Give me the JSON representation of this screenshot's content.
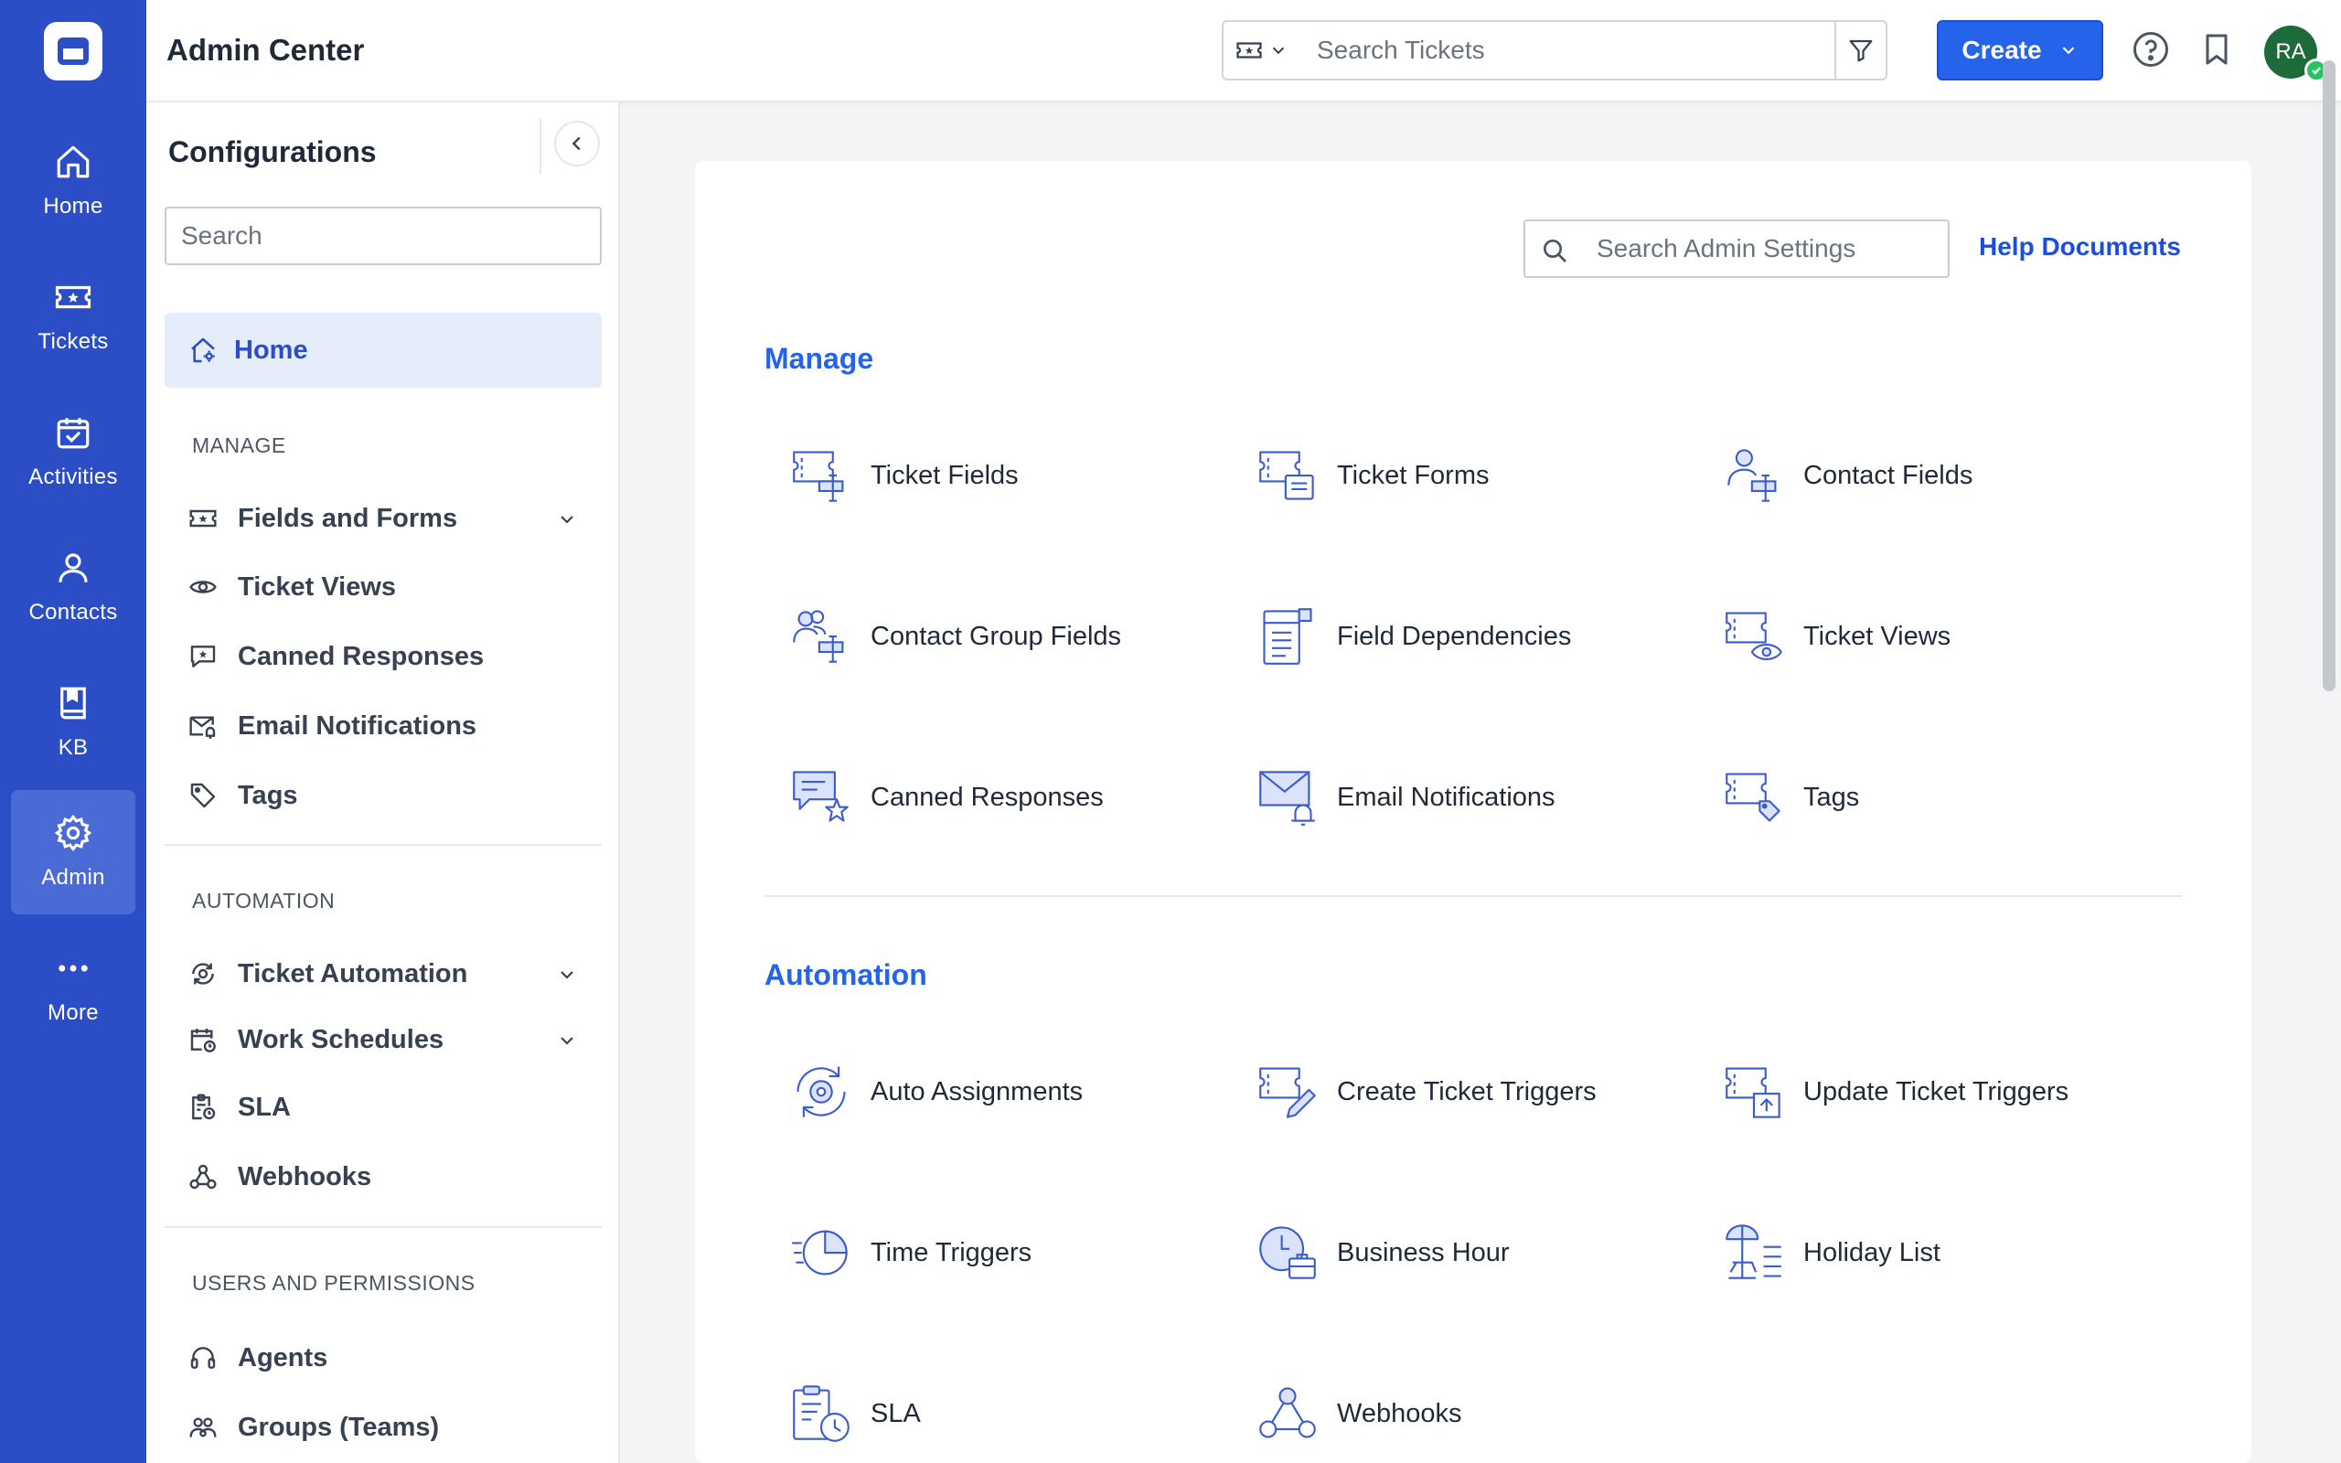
{
  "rail": {
    "items": [
      {
        "label": "Home",
        "icon": "home-icon"
      },
      {
        "label": "Tickets",
        "icon": "ticket-icon"
      },
      {
        "label": "Activities",
        "icon": "calendar-check-icon"
      },
      {
        "label": "Contacts",
        "icon": "person-icon"
      },
      {
        "label": "KB",
        "icon": "book-icon"
      },
      {
        "label": "Admin",
        "icon": "gear-icon",
        "active": true
      },
      {
        "label": "More",
        "icon": "more-dots-icon"
      }
    ]
  },
  "header": {
    "title": "Admin Center",
    "search_placeholder": "Search Tickets",
    "create_label": "Create",
    "avatar_initials": "RA"
  },
  "config": {
    "title": "Configurations",
    "search_placeholder": "Search",
    "home_label": "Home",
    "sections": {
      "manage": "MANAGE",
      "automation": "AUTOMATION",
      "users": "USERS AND PERMISSIONS"
    },
    "manage_items": [
      {
        "label": "Fields and Forms",
        "icon": "ticket-icon",
        "expandable": true
      },
      {
        "label": "Ticket Views",
        "icon": "eye-icon"
      },
      {
        "label": "Canned Responses",
        "icon": "chat-star-icon"
      },
      {
        "label": "Email Notifications",
        "icon": "mail-bell-icon"
      },
      {
        "label": "Tags",
        "icon": "tag-icon"
      }
    ],
    "automation_items": [
      {
        "label": "Ticket Automation",
        "icon": "automation-icon",
        "expandable": true
      },
      {
        "label": "Work Schedules",
        "icon": "calendar-clock-icon",
        "expandable": true
      },
      {
        "label": "SLA",
        "icon": "clipboard-clock-icon"
      },
      {
        "label": "Webhooks",
        "icon": "webhook-icon"
      }
    ],
    "users_items": [
      {
        "label": "Agents",
        "icon": "headset-icon"
      },
      {
        "label": "Groups (Teams)",
        "icon": "group-icon"
      }
    ]
  },
  "main": {
    "search_placeholder": "Search Admin Settings",
    "help_label": "Help Documents",
    "manage_title": "Manage",
    "automation_title": "Automation",
    "manage_tiles": [
      {
        "label": "Ticket Fields",
        "icon": "ticket-fields-icon"
      },
      {
        "label": "Ticket Forms",
        "icon": "ticket-forms-icon"
      },
      {
        "label": "Contact Fields",
        "icon": "contact-fields-icon"
      },
      {
        "label": "Contact Group Fields",
        "icon": "contact-group-fields-icon"
      },
      {
        "label": "Field Dependencies",
        "icon": "field-dependencies-icon"
      },
      {
        "label": "Ticket Views",
        "icon": "ticket-views-icon"
      },
      {
        "label": "Canned Responses",
        "icon": "canned-responses-icon"
      },
      {
        "label": "Email Notifications",
        "icon": "email-notifications-icon"
      },
      {
        "label": "Tags",
        "icon": "tags-icon"
      }
    ],
    "automation_tiles": [
      {
        "label": "Auto Assignments",
        "icon": "auto-assign-icon"
      },
      {
        "label": "Create Ticket Triggers",
        "icon": "create-trigger-icon"
      },
      {
        "label": "Update Ticket Triggers",
        "icon": "update-trigger-icon"
      },
      {
        "label": "Time Triggers",
        "icon": "time-trigger-icon"
      },
      {
        "label": "Business Hour",
        "icon": "business-hour-icon"
      },
      {
        "label": "Holiday List",
        "icon": "holiday-list-icon"
      },
      {
        "label": "SLA",
        "icon": "sla-icon"
      },
      {
        "label": "Webhooks",
        "icon": "webhooks-icon"
      }
    ]
  },
  "colors": {
    "rail": "#2b4ec7",
    "accent": "#2563eb",
    "active_bg": "#e5edfb",
    "avatar": "#1d6b3a"
  }
}
